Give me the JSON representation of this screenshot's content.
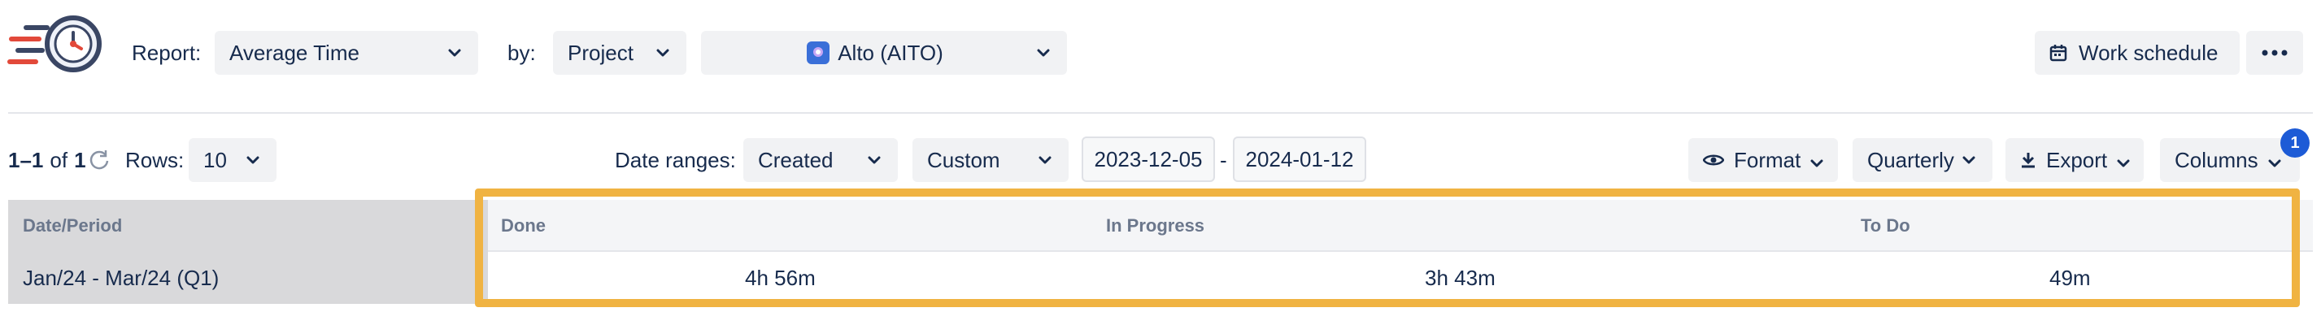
{
  "header": {
    "report_label": "Report:",
    "report_value": "Average Time",
    "by_label": "by:",
    "by_value": "Project",
    "project_value": "Alto (AITO)",
    "work_schedule_label": "Work schedule",
    "more_label": "•••"
  },
  "toolbar": {
    "pagination_range": "1–1",
    "pagination_of": "of",
    "pagination_total": "1",
    "rows_label": "Rows:",
    "rows_value": "10",
    "date_ranges_label": "Date ranges:",
    "date_field_value": "Created",
    "range_type_value": "Custom",
    "date_from": "2023-12-05",
    "date_separator": "-",
    "date_to": "2024-01-12",
    "format_label": "Format",
    "period_value": "Quarterly",
    "export_label": "Export",
    "columns_label": "Columns",
    "columns_badge": "1"
  },
  "table": {
    "headers": {
      "period": "Date/Period",
      "done": "Done",
      "in_progress": "In Progress",
      "to_do": "To Do"
    },
    "rows": [
      {
        "period": "Jan/24 - Mar/24 (Q1)",
        "done": "4h 56m",
        "in_progress": "3h 43m",
        "to_do": "49m"
      }
    ]
  },
  "colors": {
    "highlight": "#f0b342",
    "badge": "#1d5bd6",
    "text": "#172b4d"
  },
  "icons": {
    "logo": "stopwatch-logo-icon",
    "calendar": "calendar-icon",
    "eye": "eye-icon",
    "download": "download-icon",
    "refresh": "refresh-icon",
    "chevron": "chevron-down-icon"
  }
}
